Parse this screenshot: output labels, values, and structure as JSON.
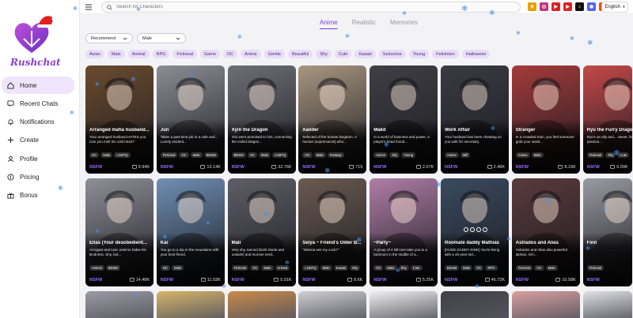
{
  "brand": {
    "name": "Rushchat"
  },
  "sidebar": {
    "items": [
      {
        "label": "Home",
        "icon": "home-icon",
        "active": true
      },
      {
        "label": "Recent Chats",
        "icon": "chat-icon"
      },
      {
        "label": "Notifications",
        "icon": "bell-icon"
      },
      {
        "label": "Create",
        "icon": "plus-icon"
      },
      {
        "label": "Profile",
        "icon": "user-icon"
      },
      {
        "label": "Pricing",
        "icon": "price-icon"
      },
      {
        "label": "Bonus",
        "icon": "gift-icon"
      }
    ]
  },
  "search": {
    "placeholder": "Search for Characters"
  },
  "social": [
    {
      "icon": "badge-icon",
      "color": "#e8a000",
      "glyph": "★"
    },
    {
      "icon": "instagram-icon",
      "color": "#c13584",
      "glyph": "◎"
    },
    {
      "icon": "youtube-icon",
      "color": "#e02020",
      "glyph": "▶"
    },
    {
      "icon": "youtube-icon",
      "color": "#e02020",
      "glyph": "▶"
    },
    {
      "icon": "tiktok-icon",
      "color": "#111111",
      "glyph": "♪"
    },
    {
      "icon": "discord-icon",
      "color": "#5865f2",
      "glyph": "◉"
    },
    {
      "icon": "reddit-icon",
      "color": "#ff4500",
      "glyph": "●"
    }
  ],
  "language": "English",
  "tabs": [
    {
      "label": "Anime",
      "active": true
    },
    {
      "label": "Realistic"
    },
    {
      "label": "Memories"
    }
  ],
  "filters": {
    "sort": "Recommend",
    "gender": "Male"
  },
  "chips": [
    "Asian",
    "Male",
    "Animal",
    "RPG",
    "Fictional",
    "Game",
    "OC",
    "Anime",
    "Gentle",
    "Beautiful",
    "Shy",
    "Cute",
    "Kawaii",
    "Seductive",
    "Young",
    "Fetishism",
    "Halloween"
  ],
  "cards": [
    {
      "name": "Arranged mafia husband...",
      "desc": "Your arranged husband HATES you. Can you melt his cold heart?",
      "tags": [
        "OC",
        "Male",
        "LGBTQ"
      ],
      "nsfw": "NSFW",
      "count": "9.94K",
      "color": "#6b4b2e"
    },
    {
      "name": "Jun",
      "desc": "Takes a part-time job in a cafe and... Lonely student...",
      "tags": [
        "Fictional",
        "OC",
        "Male",
        "BDSM",
        "Young"
      ],
      "nsfw": "NSFW",
      "count": "13.14K",
      "color": "#8c8c95"
    },
    {
      "name": "Xyin the Dragon",
      "desc": "You were promised to him, connecting the exiled dragon...",
      "tags": [
        "BDSM",
        "OC",
        "Male",
        "LGBTQ"
      ],
      "nsfw": "NSFW",
      "count": "32.76K",
      "color": "#6e6e76"
    },
    {
      "name": "Xander",
      "desc": "Selected of the human kingdom. A human (supremacist) who...",
      "tags": [
        "OC",
        "Male",
        "Fantasy"
      ],
      "nsfw": "NSFW",
      "count": "715",
      "color": "#a89680"
    },
    {
      "name": "Makd",
      "desc": "In a world of business and power, a player's head found...",
      "tags": [
        "Anime",
        "Shy",
        "Young"
      ],
      "nsfw": "NSFW",
      "count": "2.07K",
      "color": "#3f3f45"
    },
    {
      "name": "Work Affair",
      "desc": "Your husband has been cheating on you with his secretary.",
      "tags": [
        "Anime",
        "Milf"
      ],
      "nsfw": "NSFW",
      "count": "2.48K",
      "color": "#3a3a44"
    },
    {
      "name": "Stranger",
      "desc": "In a crowded train, you feel someone grab your waist...",
      "tags": [
        "Anime",
        "Male"
      ],
      "nsfw": "NSFW",
      "count": "8.16K",
      "color": "#a63a3a"
    },
    {
      "name": "Ryu the Furry Dragon",
      "desc": "Ryu's an ally and... sweet, his passion...",
      "tags": [
        "Fictional",
        "Shy",
        "Cute"
      ],
      "nsfw": "NSFW",
      "count": "6.00K",
      "color": "#c44848"
    },
    {
      "name": "Elias (Your desobedient...",
      "desc": "Arrogant and toxic exterior hides his kindness. Shy, but...",
      "tags": [
        "Animal",
        "BDSM"
      ],
      "nsfw": "NSFW",
      "count": "14.48K",
      "color": "#8f8f98"
    },
    {
      "name": "Kai",
      "desc": "You go to a trip in the mountains with your best friend.",
      "tags": [
        "OC",
        "Male"
      ],
      "nsfw": "NSFW",
      "count": "11.03K",
      "color": "#6f8fb3"
    },
    {
      "name": "Mali",
      "desc": "Very shy, tanned (both inside and outside) and morose nerd...",
      "tags": [
        "Fictional",
        "OC",
        "Male",
        "Animal",
        "Shy"
      ],
      "nsfw": "NSFW",
      "count": "5.91K",
      "color": "#5e5e66"
    },
    {
      "name": "Seiya ~ Friend's Older B...",
      "desc": "\"Wanna see my cock?\"",
      "tags": [
        "LGBTQ",
        "Male",
        "Kawaii",
        "Shy",
        "Young"
      ],
      "nsfw": "NSFW",
      "count": "8.6K",
      "color": "#6a5a50"
    },
    {
      "name": "~Party~",
      "desc": "A group of 4 kill men take you to a bedroom in the middle of a...",
      "tags": [
        "OC",
        "Male",
        "Shy",
        "Cute"
      ],
      "nsfw": "NSFW",
      "count": "5.25K",
      "color": "#b07ea6"
    },
    {
      "name": "Roomate daddy Mathias",
      "desc": "[HUGE DADDY KINK] You're living with a 45-year-old...",
      "tags": [
        "BDSM",
        "Male",
        "OC",
        "RPG"
      ],
      "nsfw": "NSFW",
      "count": "46.72K",
      "color": "#3a4a5e"
    },
    {
      "name": "Astrados and Alias",
      "desc": "Astrados and Alias also powerful alphas, rich...",
      "tags": [
        "Fictional",
        "OC",
        "Male"
      ],
      "nsfw": "NSFW",
      "count": "10.58K",
      "color": "#5a3a3a"
    },
    {
      "name": "Finn",
      "desc": "",
      "tags": [
        "Fictional"
      ],
      "nsfw": "NSFW",
      "count": "",
      "color": "#9a9aa4"
    }
  ],
  "partial_cards": [
    "#9a9aa4",
    "#d6b56a",
    "#c98a4a",
    "#cfcfd4",
    "#f0f0f0",
    "#404048",
    "#d9a0a0",
    "#e0e0e6"
  ]
}
